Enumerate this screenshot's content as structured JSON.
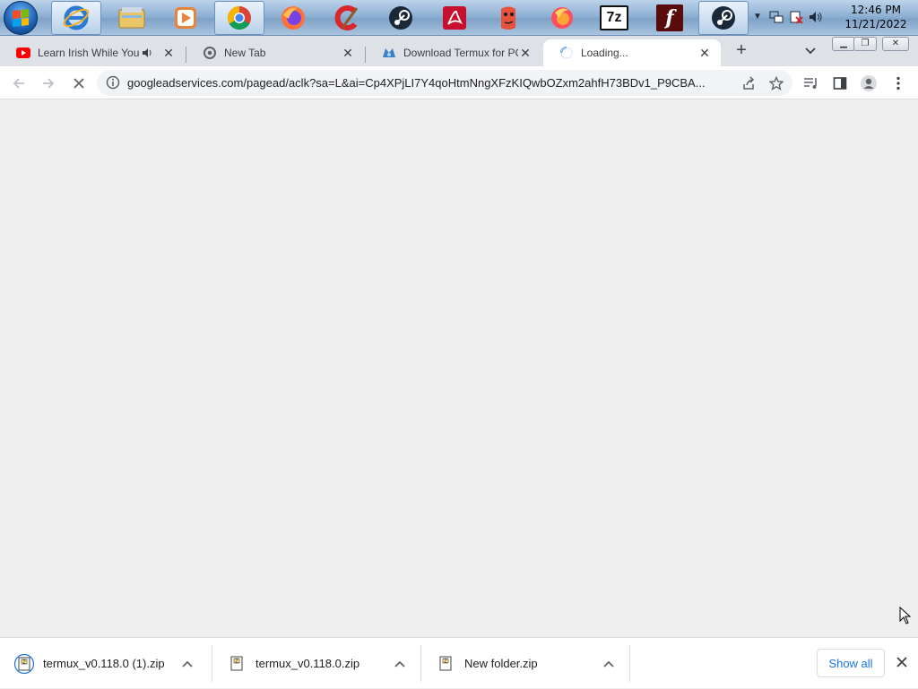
{
  "taskbar": {
    "apps": [
      {
        "name": "Internet Explorer",
        "icon": "internet-explorer-icon"
      },
      {
        "name": "File Explorer",
        "icon": "file-explorer-icon"
      },
      {
        "name": "Media Player",
        "icon": "media-player-icon"
      },
      {
        "name": "Google Chrome",
        "icon": "chrome-icon"
      },
      {
        "name": "Firefox",
        "icon": "firefox-icon"
      },
      {
        "name": "CCleaner",
        "icon": "ccleaner-icon"
      },
      {
        "name": "Steam",
        "icon": "steam-icon"
      },
      {
        "name": "Adobe Reader",
        "icon": "acrobat-icon"
      },
      {
        "name": "Hexchat",
        "icon": "face-icon"
      },
      {
        "name": "Firefox Nightly",
        "icon": "firefox-nightly-icon"
      },
      {
        "name": "7-Zip",
        "icon": "7zip-icon",
        "label": "7z"
      },
      {
        "name": "Flash",
        "icon": "flash-icon",
        "label": "f"
      },
      {
        "name": "Steam",
        "icon": "steam-icon"
      }
    ],
    "clock": {
      "time": "12:46 PM",
      "date": "11/21/2022"
    }
  },
  "tabs": [
    {
      "title": "Learn Irish While You",
      "icon": "youtube-icon",
      "audio": true,
      "active": false
    },
    {
      "title": "New Tab",
      "icon": "chrome-icon",
      "active": false
    },
    {
      "title": "Download Termux for PC",
      "icon": "site-icon",
      "active": false
    },
    {
      "title": "Loading...",
      "icon": "loading-spinner-icon",
      "active": true
    }
  ],
  "toolbar": {
    "url": "googleadservices.com/pagead/aclk?sa=L&ai=Cp4XPjLI7Y4qoHtmNngXFzKIQwbOZxm2ahfH73BDv1_P9CBA..."
  },
  "downloads": {
    "items": [
      {
        "name": "termux_v0.118.0 (1).zip"
      },
      {
        "name": "termux_v0.118.0.zip"
      },
      {
        "name": "New folder.zip"
      }
    ],
    "show_all": "Show all"
  },
  "colors": {
    "accent": "#1a73e8",
    "tabstrip": "#dee1e6",
    "content_bg": "#efefef"
  }
}
